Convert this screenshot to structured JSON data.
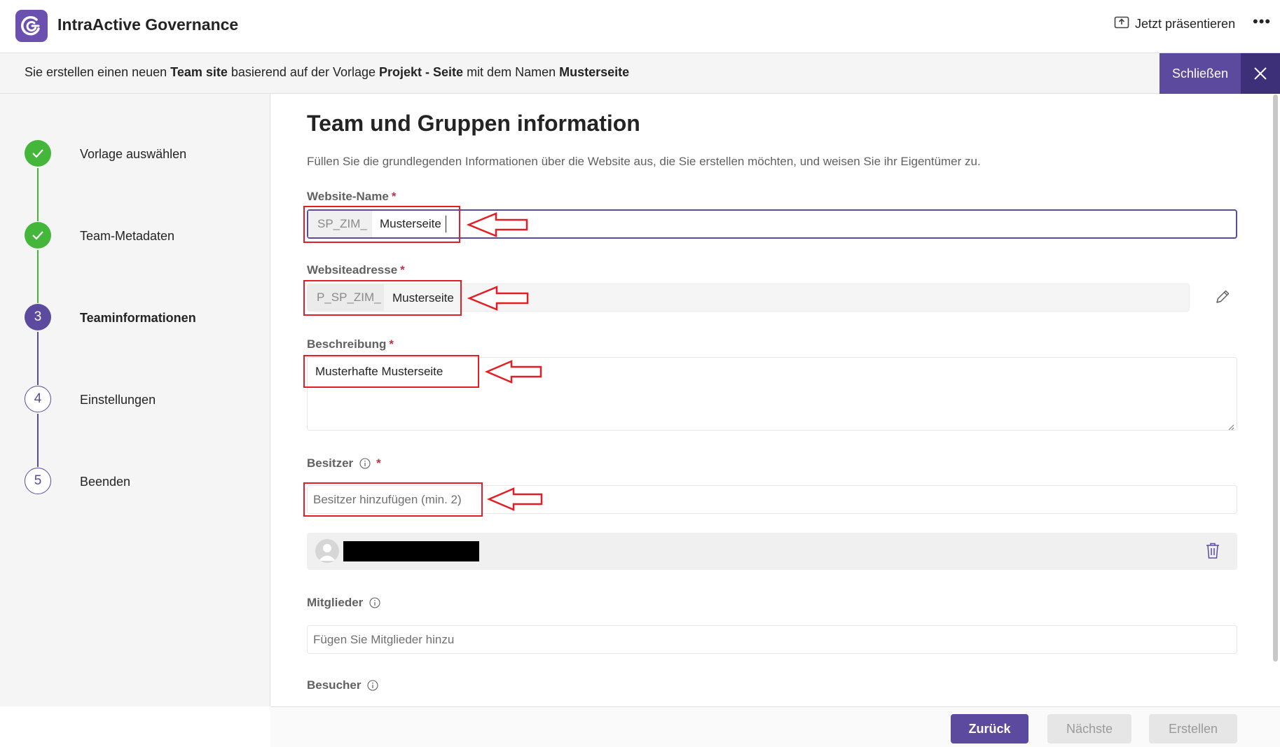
{
  "header": {
    "app_title": "IntraActive Governance",
    "present_label": "Jetzt präsentieren",
    "more_label": "•••"
  },
  "info_bar": {
    "t1": "Sie erstellen einen neuen ",
    "site_type": "Team site",
    "t2": " basierend auf der Vorlage ",
    "template": "Projekt - Seite",
    "t3": " mit dem Namen ",
    "name": "Musterseite",
    "close_label": "Schließen"
  },
  "steps": [
    {
      "label": "Vorlage auswählen",
      "status": "done"
    },
    {
      "label": "Team-Metadaten",
      "status": "done"
    },
    {
      "number": "3",
      "label": "Teaminformationen",
      "status": "active"
    },
    {
      "number": "4",
      "label": "Einstellungen",
      "status": "todo"
    },
    {
      "number": "5",
      "label": "Beenden",
      "status": "todo"
    }
  ],
  "form": {
    "title": "Team und Gruppen information",
    "description": "Füllen Sie die grundlegenden Informationen über die Website aus, die Sie erstellen möchten, und weisen Sie ihr Eigentümer zu.",
    "site_name": {
      "label": "Website-Name",
      "required": "*",
      "prefix": "SP_ZIM_",
      "value": "Musterseite"
    },
    "site_address": {
      "label": "Websiteadresse",
      "required": "*",
      "prefix": "P_SP_ZIM_",
      "value": "Musterseite"
    },
    "description_field": {
      "label": "Beschreibung",
      "required": "*",
      "value": "Musterhafte Musterseite"
    },
    "owners": {
      "label": "Besitzer",
      "required": "*",
      "placeholder": "Besitzer hinzufügen (min. 2)"
    },
    "members": {
      "label": "Mitglieder",
      "placeholder": "Fügen Sie Mitglieder hinzu"
    },
    "visitors": {
      "label": "Besucher"
    }
  },
  "footer": {
    "back_label": "Zurück",
    "next_label": "Nächste",
    "create_label": "Erstellen"
  },
  "colors": {
    "brand": "#5b4a9e",
    "done": "#44b73b",
    "annotation": "#e31e24"
  }
}
